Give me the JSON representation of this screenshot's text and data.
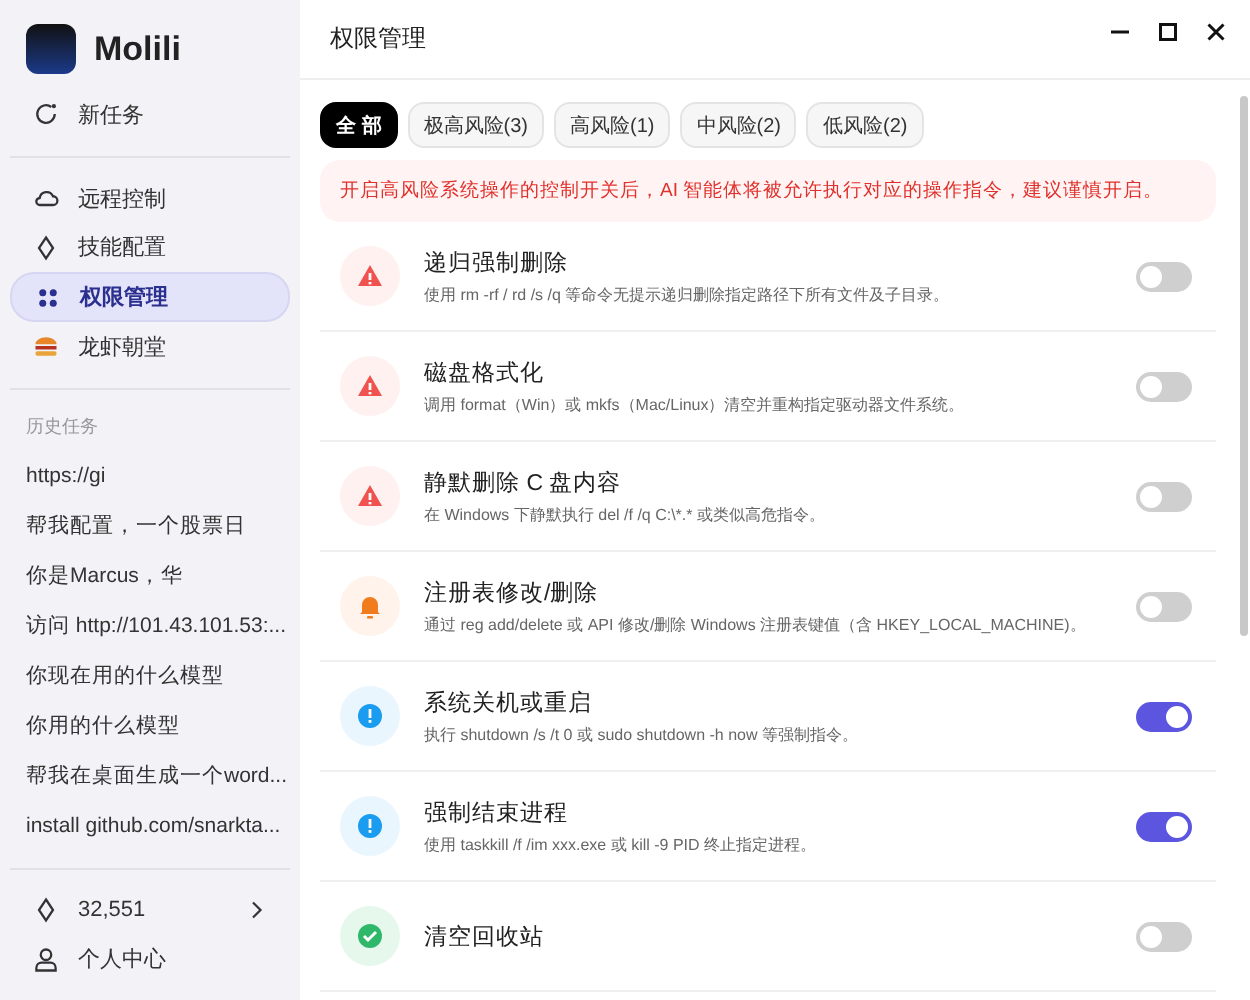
{
  "app": {
    "name": "Molili"
  },
  "sidebar": {
    "new_task": "新任务",
    "items": [
      {
        "label": "远程控制",
        "selected": false
      },
      {
        "label": "技能配置",
        "selected": false
      },
      {
        "label": "权限管理",
        "selected": true
      },
      {
        "label": "龙虾朝堂",
        "selected": false
      }
    ],
    "history_label": "历史任务",
    "history": [
      "https://gi",
      "帮我配置，一个股票日",
      "你是Marcus，华",
      "访问 http://101.43.101.53:...",
      "你现在用的什么模型",
      "你用的什么模型",
      "帮我在桌面生成一个word...",
      "install github.com/snarkta..."
    ],
    "credits": "32,551",
    "profile": "个人中心"
  },
  "window": {
    "title": "权限管理"
  },
  "tabs": [
    {
      "label": "全 部",
      "selected": true
    },
    {
      "label": "极高风险(3)",
      "selected": false
    },
    {
      "label": "高风险(1)",
      "selected": false
    },
    {
      "label": "中风险(2)",
      "selected": false
    },
    {
      "label": "低风险(2)",
      "selected": false
    }
  ],
  "notice": "开启高风险系统操作的控制开关后，AI 智能体将被允许执行对应的操作指令，建议谨慎开启。",
  "permissions": [
    {
      "kind": "critical",
      "title": "递归强制删除",
      "description": "使用 rm -rf / rd /s /q 等命令无提示递归删除指定路径下所有文件及子目录。",
      "on": false
    },
    {
      "kind": "critical",
      "title": "磁盘格式化",
      "description": "调用 format（Win）或 mkfs（Mac/Linux）清空并重构指定驱动器文件系统。",
      "on": false
    },
    {
      "kind": "critical",
      "title": "静默删除 C 盘内容",
      "description": "在 Windows 下静默执行 del /f /q C:\\*.* 或类似高危指令。",
      "on": false
    },
    {
      "kind": "high",
      "title": "注册表修改/删除",
      "description": "通过 reg add/delete 或 API 修改/删除 Windows 注册表键值（含 HKEY_LOCAL_MACHINE)。",
      "on": false
    },
    {
      "kind": "medium",
      "title": "系统关机或重启",
      "description": "执行 shutdown /s /t 0 或 sudo shutdown -h now 等强制指令。",
      "on": true
    },
    {
      "kind": "medium",
      "title": "强制结束进程",
      "description": "使用 taskkill /f /im xxx.exe 或 kill -9 PID 终止指定进程。",
      "on": true
    },
    {
      "kind": "low",
      "title": "清空回收站",
      "on": false
    }
  ]
}
